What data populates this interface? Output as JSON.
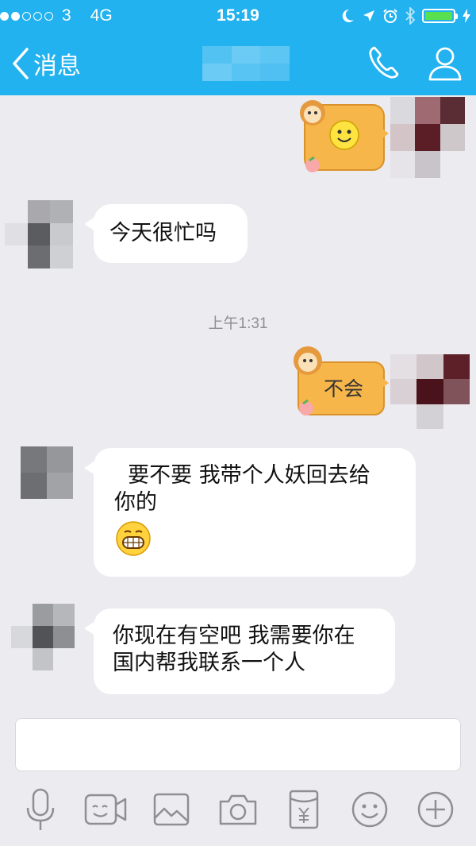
{
  "status_bar": {
    "carrier": "3",
    "network": "4G",
    "time": "15:19",
    "signal_bars_filled": 2,
    "signal_bars_total": 5,
    "battery_level": 1.0
  },
  "nav": {
    "back_label": "消息",
    "icons": [
      "chevron-left-icon",
      "phone-icon",
      "profile-icon"
    ]
  },
  "messages": [
    {
      "direction": "out",
      "type": "sticker",
      "text": ""
    },
    {
      "direction": "in",
      "type": "text",
      "lines": [
        "今天很忙吗"
      ]
    },
    {
      "type": "timestamp",
      "text": "上午1:31"
    },
    {
      "direction": "out",
      "type": "sticker",
      "text": "不会"
    },
    {
      "direction": "in",
      "type": "text",
      "lines": [
        "  要不要 我带个人妖回去给",
        "你的"
      ],
      "emoji": "grinning-face"
    },
    {
      "direction": "in",
      "type": "text",
      "lines": [
        "你现在有空吧 我需要你在",
        "国内帮我联系一个人"
      ]
    }
  ],
  "input": {
    "placeholder": ""
  },
  "toolbar": {
    "icons": [
      "microphone-icon",
      "video-icon",
      "image-icon",
      "camera-icon",
      "red-packet-icon",
      "emoji-icon",
      "plus-icon"
    ]
  },
  "colors": {
    "header": "#21b2ef",
    "background": "#ebebf0",
    "bubble_in": "#ffffff",
    "sticker_yellow": "#f7b64a",
    "battery": "#59e04f"
  }
}
